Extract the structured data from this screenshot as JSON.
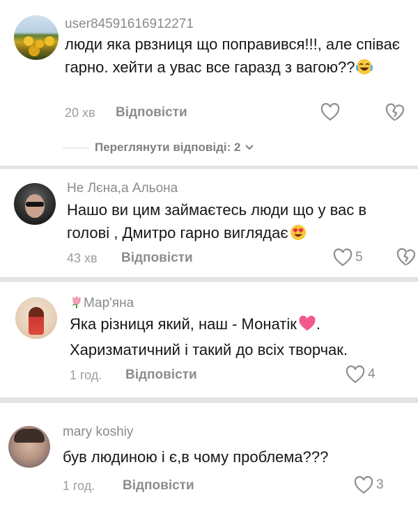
{
  "comments": [
    {
      "username": "user84591616912271",
      "text": "люди яка рвзниця що поправився!!!, але співає гарно. хейти а увас все гаразд з вагою??",
      "emoji": "face-with-tears-of-joy",
      "time": "20 хв",
      "reply_label": "Відповісти",
      "likes": "",
      "view_replies": "Переглянути відповіді: 2"
    },
    {
      "username": "Не Лєна,а Альона",
      "text": "Нашо ви цим займаєтесь люди що у вас в голові , Дмитро гарно виглядає",
      "emoji": "heart-eyes",
      "time": "43 хв",
      "reply_label": "Відповісти",
      "likes": "5"
    },
    {
      "username": "Мар'яна",
      "username_emoji": "tulip",
      "text": "Яка різниця який, наш - Монатік",
      "text_after": ". Харизматичний і такий до всіх творчак.",
      "emoji": "pink-heart",
      "time": "1 год.",
      "reply_label": "Відповісти",
      "likes": "4"
    },
    {
      "username": "mary koshiy",
      "text": "був людиною і є,в чому проблема???",
      "time": "1 год.",
      "reply_label": "Відповісти",
      "likes": "3"
    }
  ],
  "colors": {
    "background": "#e3e3e3",
    "card": "#ffffff",
    "username": "#8a8a8a",
    "text": "#161616",
    "meta": "#9d9d9d"
  }
}
